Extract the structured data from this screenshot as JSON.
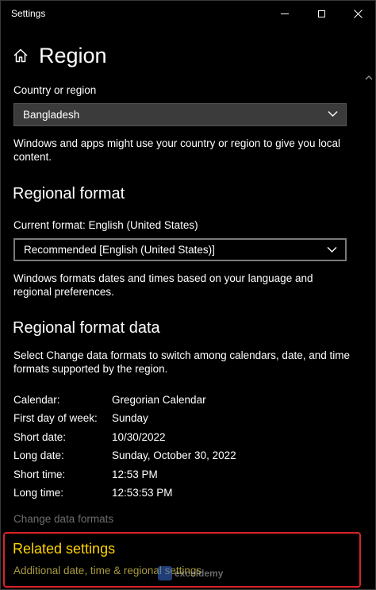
{
  "window": {
    "title": "Settings"
  },
  "header": {
    "title": "Region"
  },
  "country": {
    "label": "Country or region",
    "value": "Bangladesh",
    "description": "Windows and apps might use your country or region to give you local content."
  },
  "regional_format": {
    "heading": "Regional format",
    "current_label": "Current format: English (United States)",
    "value": "Recommended [English (United States)]",
    "description": "Windows formats dates and times based on your language and regional preferences."
  },
  "format_data": {
    "heading": "Regional format data",
    "description": "Select Change data formats to switch among calendars, date, and time formats supported by the region.",
    "rows": [
      {
        "label": "Calendar:",
        "value": "Gregorian Calendar"
      },
      {
        "label": "First day of week:",
        "value": "Sunday"
      },
      {
        "label": "Short date:",
        "value": "10/30/2022"
      },
      {
        "label": "Long date:",
        "value": "Sunday, October 30, 2022"
      },
      {
        "label": "Short time:",
        "value": "12:53 PM"
      },
      {
        "label": "Long time:",
        "value": "12:53:53 PM"
      }
    ],
    "change_link": "Change data formats"
  },
  "related": {
    "heading": "Related settings",
    "link": "Additional date, time & regional settings"
  },
  "watermark": {
    "text": "exceldemy"
  },
  "colors": {
    "background": "#000000",
    "highlight_border": "#d8232a",
    "related_heading": "#ffd400"
  }
}
